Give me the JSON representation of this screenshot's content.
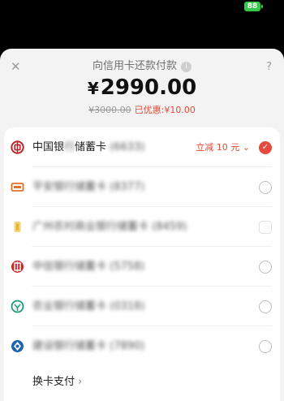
{
  "status_bar": {
    "battery": "88"
  },
  "header": {
    "close_icon": "close-icon",
    "title": "向信用卡还款付款",
    "info_glyph": "i",
    "help": "?"
  },
  "payment": {
    "currency": "¥",
    "amount": "2990.00",
    "original_price": "¥3000.00",
    "discount_text": "已优惠:¥10.00"
  },
  "cards": [
    {
      "bank": "中国银行储蓄卡",
      "bank_clear": "中国银",
      "bank_blur": "行",
      "type_clear": "储蓄卡",
      "tail": "(6633)",
      "promo": "立减 10 元",
      "chevron": "⌄",
      "selected": true,
      "icon": "boc-icon",
      "icon_color": "#b8282e"
    },
    {
      "bank": "平安银行储蓄卡",
      "blurred": "平安银行储蓄卡",
      "tail": "(8377)",
      "selected": false,
      "icon": "pingan-icon",
      "icon_color": "#e0702a"
    },
    {
      "bank": "广州农村商业银行储蓄卡",
      "blurred": "广州农村商业银行储蓄卡",
      "tail": "(8459)",
      "selected": false,
      "disabled": true,
      "icon": "grcb-icon",
      "icon_color": "#e0b340"
    },
    {
      "bank": "中信银行储蓄卡",
      "blurred": "中信银行储蓄卡",
      "tail": "(5758)",
      "selected": false,
      "icon": "citic-icon",
      "icon_color": "#c42a2a"
    },
    {
      "bank": "农业银行储蓄卡",
      "blurred": "农业银行储蓄卡",
      "tail": "(0318)",
      "selected": false,
      "icon": "abc-icon",
      "icon_color": "#1d9a7a"
    },
    {
      "bank": "建设银行储蓄卡",
      "blurred": "建设银行储蓄卡",
      "tail": "(7890)",
      "selected": false,
      "icon": "ccb-icon",
      "icon_color": "#1f63b0"
    }
  ],
  "footer": {
    "change_card": "换卡支付",
    "chevron": "›"
  }
}
